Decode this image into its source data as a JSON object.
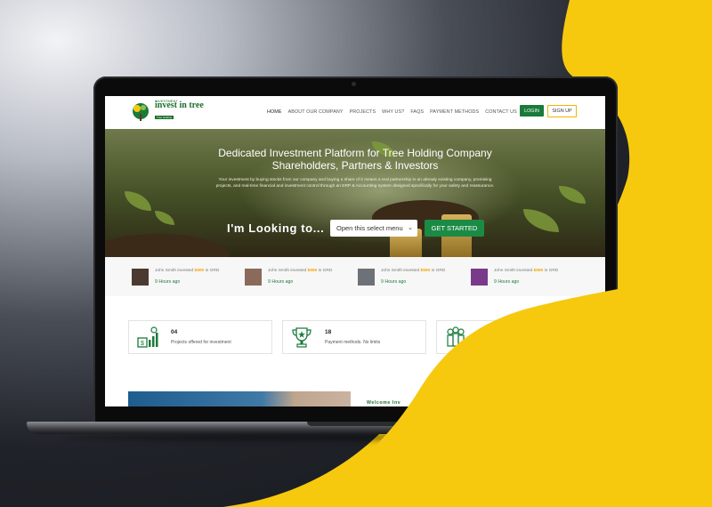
{
  "nav": {
    "logo": {
      "top_text": "INVESTMENT",
      "main_text": "invest in tree",
      "sub_text": "Tree Holding"
    },
    "menu": [
      "HOME",
      "ABOUT OUR COMPANY",
      "PROJECTS",
      "WHY US?",
      "FAQS",
      "PAYMENT METHODS",
      "CONTACT US"
    ],
    "login_label": "LOGIN",
    "signup_label": "SIGN UP"
  },
  "hero": {
    "title_line1": "Dedicated Investment Platform for Tree Holding Company",
    "title_line2": "Shareholders, Partners & Investors",
    "description": "Your investment by buying stocks from our company and buying a share of it means a real partnership in an already existing company, promising projects, and real-time financial and investment control through an ERP & Accounting system designed specifically for your safety and reassurance.",
    "looking_label": "I'm Looking to...",
    "select_value": "Open this select menu",
    "cta_label": "GET STARTED"
  },
  "activity": [
    {
      "name": "John Smith invested",
      "amount": "$500",
      "unit": "in GRD",
      "time": "9 Hours ago"
    },
    {
      "name": "John Smith invested",
      "amount": "$500",
      "unit": "in GRD",
      "time": "9 Hours ago"
    },
    {
      "name": "John Smith invested",
      "amount": "$500",
      "unit": "in GRD",
      "time": "9 Hours ago"
    },
    {
      "name": "John Smith invested",
      "amount": "$500",
      "unit": "in GRD",
      "time": "9 Hours ago"
    }
  ],
  "stats": [
    {
      "number": "04",
      "label": "Projects offered for investment",
      "icon": "investment-chart-icon"
    },
    {
      "number": "18",
      "label": "Payment methods. No limits",
      "icon": "trophy-icon"
    },
    {
      "number": "",
      "label": "",
      "icon": "people-icon"
    }
  ],
  "welcome": {
    "text": "Welcome Inv"
  },
  "colors": {
    "brand_green": "#1b7a3a",
    "accent_yellow": "#f6c90e",
    "amount_orange": "#f0a500"
  }
}
